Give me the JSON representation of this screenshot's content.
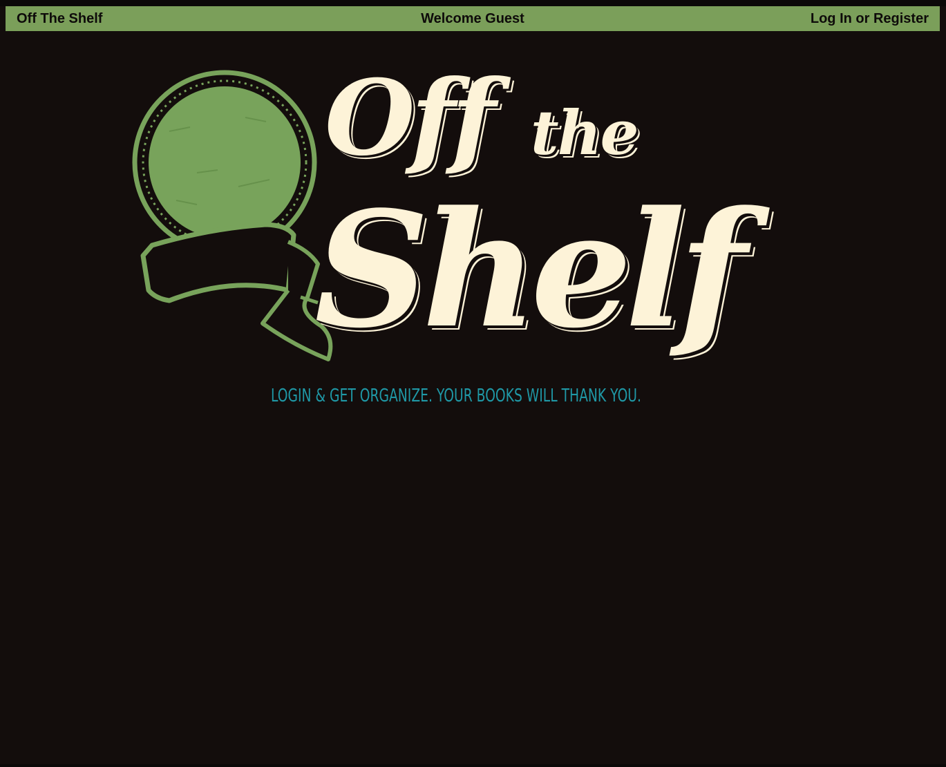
{
  "navbar": {
    "brand": "Off The Shelf",
    "welcome": "Welcome Guest",
    "login": "Log In or Register"
  },
  "logo": {
    "title_line1": "Off",
    "title_line1b": "the",
    "title_line2": "Shelf",
    "tagline": "LOGIN & GET ORGANIZE. YOUR BOOKS WILL THANK YOU.",
    "icon": "globe-banner-icon"
  },
  "colors": {
    "background": "#130d0c",
    "navbar": "#7b9f5a",
    "logo_cream": "#fdf3d8",
    "logo_green": "#78a35b",
    "tagline": "#1f98a6"
  }
}
